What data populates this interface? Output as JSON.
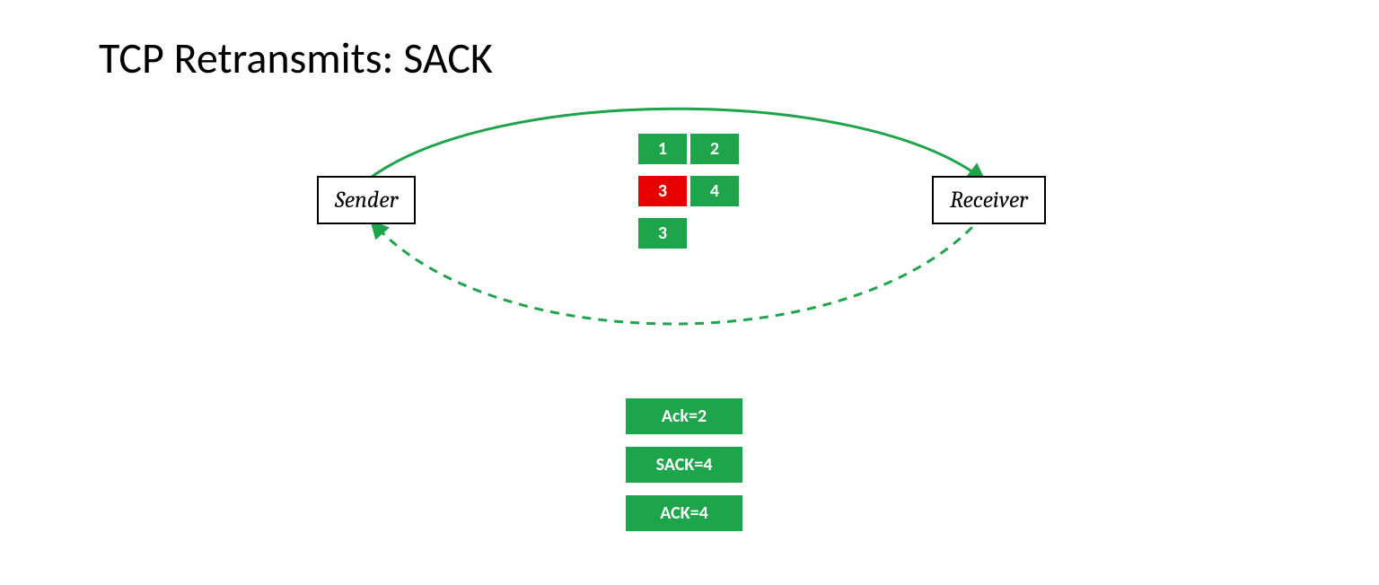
{
  "title": "TCP Retransmits: SACK",
  "sender_label": "Sender",
  "receiver_label": "Receiver",
  "colors": {
    "green": "#1ea44a",
    "red": "#e60000"
  },
  "packet_rows": [
    {
      "cells": [
        {
          "label": "1",
          "kind": "ok"
        },
        {
          "label": "2",
          "kind": "ok"
        }
      ]
    },
    {
      "cells": [
        {
          "label": "3",
          "kind": "lost"
        },
        {
          "label": "4",
          "kind": "ok"
        }
      ]
    },
    {
      "cells": [
        {
          "label": "3",
          "kind": "ok"
        }
      ]
    }
  ],
  "ack_messages": [
    "Ack=2",
    "SACK=4",
    "ACK=4"
  ]
}
